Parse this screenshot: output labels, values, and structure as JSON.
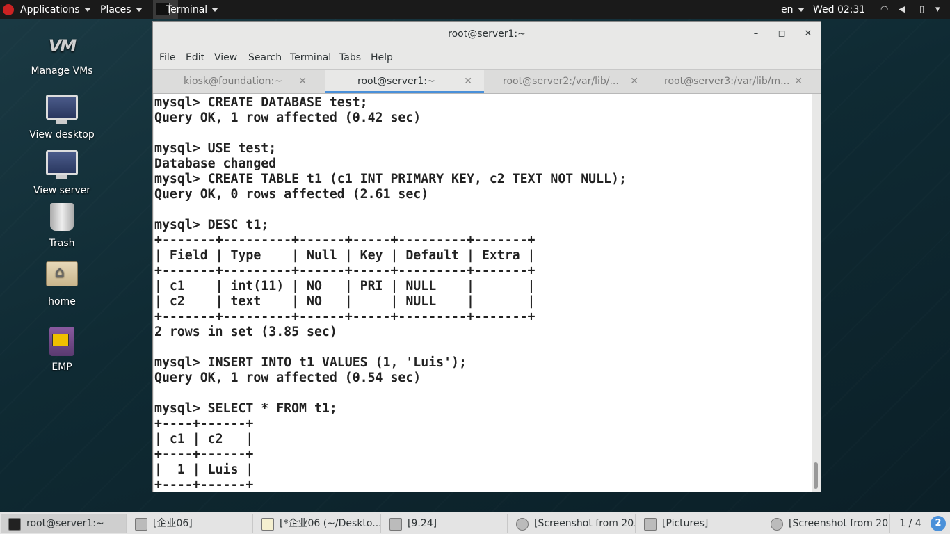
{
  "topbar": {
    "applications": "Applications",
    "places": "Places",
    "terminal": "Terminal",
    "lang": "en",
    "clock": "Wed 02:31"
  },
  "desktop": [
    {
      "name": "desktop-icon-manage-vms",
      "label": "Manage VMs",
      "icon": "vm-logo-icon"
    },
    {
      "name": "desktop-icon-view-desktop",
      "label": "View desktop",
      "icon": "monitor-icon"
    },
    {
      "name": "desktop-icon-view-server",
      "label": "View server",
      "icon": "monitor-icon"
    },
    {
      "name": "desktop-icon-trash",
      "label": "Trash",
      "icon": "trash-icon"
    },
    {
      "name": "desktop-icon-home",
      "label": "home",
      "icon": "folder-home-icon"
    },
    {
      "name": "desktop-icon-emp",
      "label": "EMP",
      "icon": "app-icon"
    }
  ],
  "window": {
    "title": "root@server1:~",
    "menu": [
      "File",
      "Edit",
      "View",
      "Search",
      "Terminal",
      "Tabs",
      "Help"
    ],
    "tabs": [
      {
        "label": "kiosk@foundation:~",
        "active": false
      },
      {
        "label": "root@server1:~",
        "active": true
      },
      {
        "label": "root@server2:/var/lib/...",
        "active": false
      },
      {
        "label": "root@server3:/var/lib/m...",
        "active": false
      }
    ],
    "terminal_text": "mysql> CREATE DATABASE test;\nQuery OK, 1 row affected (0.42 sec)\n\nmysql> USE test;\nDatabase changed\nmysql> CREATE TABLE t1 (c1 INT PRIMARY KEY, c2 TEXT NOT NULL);\nQuery OK, 0 rows affected (2.61 sec)\n\nmysql> DESC t1;\n+-------+---------+------+-----+---------+-------+\n| Field | Type    | Null | Key | Default | Extra |\n+-------+---------+------+-----+---------+-------+\n| c1    | int(11) | NO   | PRI | NULL    |       |\n| c2    | text    | NO   |     | NULL    |       |\n+-------+---------+------+-----+---------+-------+\n2 rows in set (3.85 sec)\n\nmysql> INSERT INTO t1 VALUES (1, 'Luis');\nQuery OK, 1 row affected (0.54 sec)\n\nmysql> SELECT * FROM t1;\n+----+------+\n| c1 | c2   |\n+----+------+\n|  1 | Luis |\n+----+------+"
  },
  "taskbar": {
    "tasks": [
      {
        "label": "root@server1:~",
        "active": true
      },
      {
        "label": "[企业06]",
        "active": false
      },
      {
        "label": "[*企业06 (~/Deskto...",
        "active": false
      },
      {
        "label": "[9.24]",
        "active": false
      },
      {
        "label": "[Screenshot from 20...",
        "active": false
      },
      {
        "label": "[Pictures]",
        "active": false
      },
      {
        "label": "[Screenshot from 20...",
        "active": false
      }
    ],
    "workspace": "1 / 4",
    "notifications": "2"
  },
  "colors": {
    "accent": "#4a90d9",
    "topbar": "#1a1a1a",
    "terminal_bg": "#ffffff",
    "terminal_fg": "#222222"
  }
}
